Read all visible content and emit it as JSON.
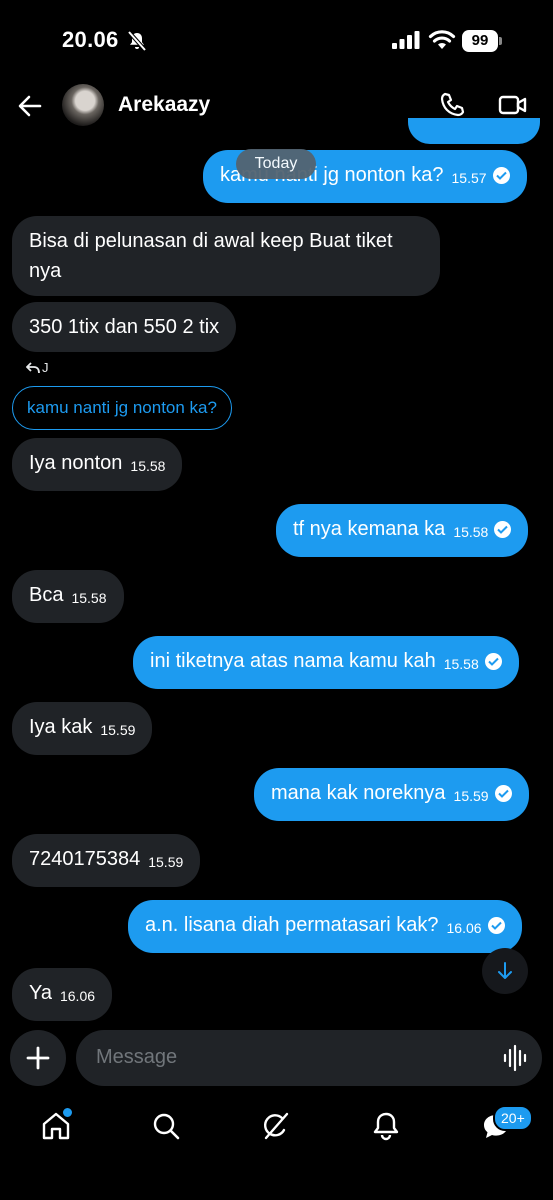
{
  "status_bar": {
    "time": "20.06",
    "battery": "99"
  },
  "header": {
    "contact_name": "Arekaazy"
  },
  "date_divider": "Today",
  "messages": [
    {
      "text": "kamu nanti jg nonton ka?",
      "time": "15.57"
    },
    {
      "text": "Bisa di pelunasan di awal keep Buat tiket nya"
    },
    {
      "text": "350 1tix dan 550 2 tix"
    },
    {
      "reply_sender": "J",
      "reply_quote": "kamu nanti jg nonton ka?"
    },
    {
      "text": "Iya nonton",
      "time": "15.58"
    },
    {
      "text": "tf nya kemana ka",
      "time": "15.58"
    },
    {
      "text": "Bca",
      "time": "15.58"
    },
    {
      "text": "ini tiketnya atas nama kamu kah",
      "time": "15.58"
    },
    {
      "text": "Iya kak",
      "time": "15.59"
    },
    {
      "text": "mana kak noreknya",
      "time": "15.59"
    },
    {
      "text": "7240175384",
      "time": "15.59"
    },
    {
      "text": "a.n. lisana diah permatasari kak?",
      "time": "16.06"
    },
    {
      "text": "Ya",
      "time": "16.06"
    }
  ],
  "composer": {
    "placeholder": "Message"
  },
  "bottom_nav": {
    "items": [
      "home-icon",
      "search-icon",
      "grok-icon",
      "notifications-icon",
      "messages-icon"
    ],
    "messages_badge": "20+"
  },
  "colors": {
    "accent": "#1d9bf0",
    "incoming_bubble": "#202327",
    "background": "#000000"
  }
}
